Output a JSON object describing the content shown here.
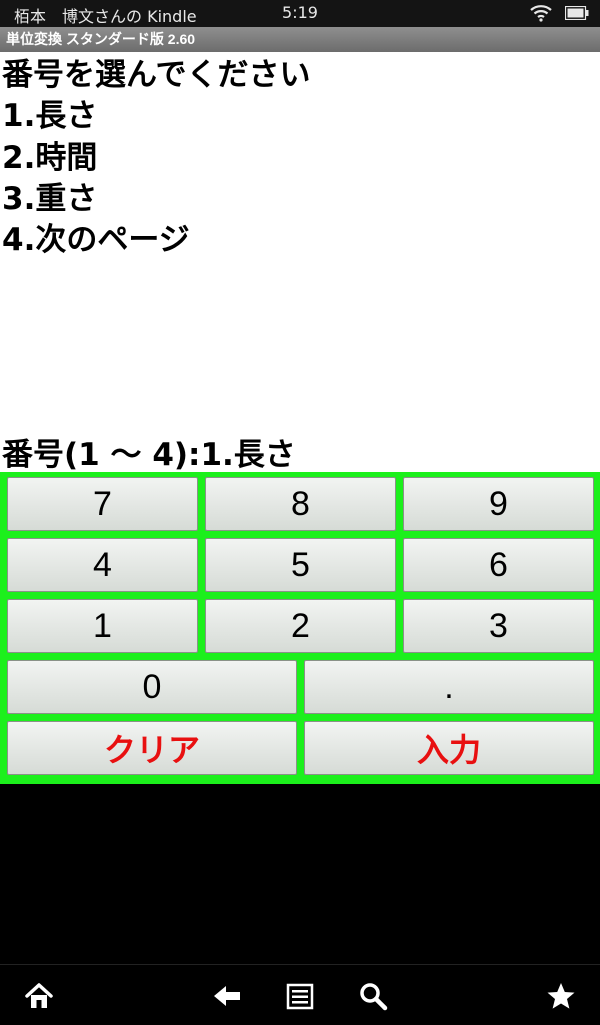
{
  "status_bar": {
    "owner": "栢本　博文さんの Kindle",
    "time": "5:19"
  },
  "title_bar": {
    "title": "単位変換 スタンダード版 2.60"
  },
  "content": {
    "heading": "番号を選んでください",
    "options": [
      "1.長さ",
      "2.時間",
      "3.重さ",
      "4.次のページ"
    ],
    "prompt": "番号(1 ～ 4):1.長さ"
  },
  "keypad": {
    "keys": {
      "k7": "7",
      "k8": "8",
      "k9": "9",
      "k4": "4",
      "k5": "5",
      "k6": "6",
      "k1": "1",
      "k2": "2",
      "k3": "3",
      "k0": "0",
      "dot": ".",
      "clear": "クリア",
      "enter": "入力"
    },
    "background_color": "#1cf01c",
    "action_text_color": "#e81010"
  },
  "nav_bar": {
    "icons": [
      "home-icon",
      "back-icon",
      "menu-icon",
      "search-icon",
      "favorites-icon"
    ]
  }
}
